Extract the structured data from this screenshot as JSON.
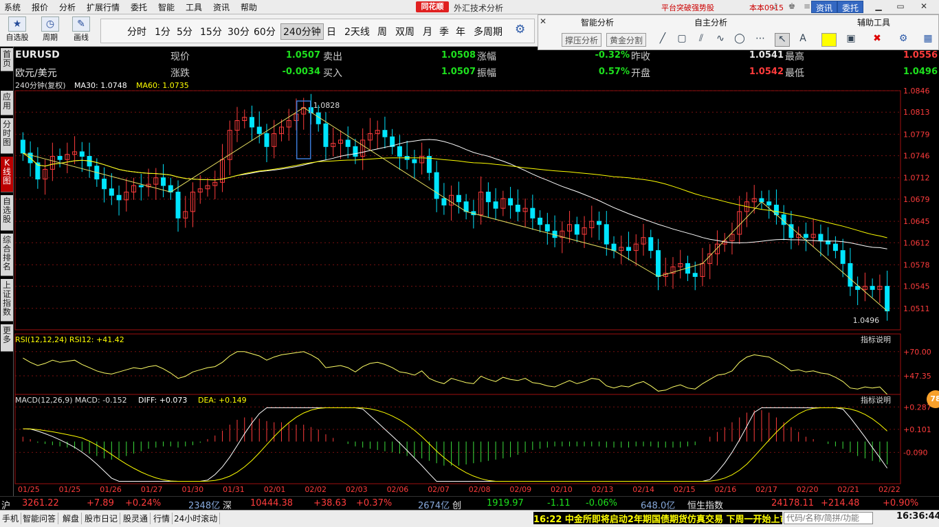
{
  "menu": [
    "系统",
    "报价",
    "分析",
    "扩展行情",
    "委托",
    "智能",
    "工具",
    "资讯",
    "帮助"
  ],
  "logo": "同花顺",
  "app_title": "外汇技术分析",
  "promo": "平台突破强势股",
  "account": "本本0915",
  "btn_news": "资讯",
  "btn_trade": "委托",
  "toolbar": {
    "self_select": "自选股",
    "cycle": "周期",
    "draw": "画线"
  },
  "periods": [
    "分时",
    "1分",
    "5分",
    "15分",
    "30分",
    "60分",
    "240分钟",
    "日",
    "2天线",
    "周",
    "双周",
    "月",
    "季",
    "年",
    "多周期"
  ],
  "active_period": "240分钟",
  "analysis": {
    "smart_title": "智能分析",
    "own_title": "自主分析",
    "aux_title": "辅助工具",
    "pressure": "撑压分析",
    "golden": "黄金分割",
    "colors": {
      "swatch": "#ffff00"
    }
  },
  "sidebar": [
    "首页",
    "应用",
    "分时图",
    "K线图",
    "自选股",
    "综合排名",
    "上证指数",
    "更多"
  ],
  "quote": {
    "code": "EURUSD",
    "name": "欧元/美元",
    "l_price": "现价",
    "price": "1.0507",
    "l_sell": "卖出",
    "sell": "1.0508",
    "l_change_pct": "涨幅",
    "change_pct": "-0.32%",
    "l_prev_close": "昨收",
    "prev_close": "1.0541",
    "l_high": "最高",
    "high": "1.0556",
    "l_change": "涨跌",
    "change": "-0.0034",
    "l_buy": "买入",
    "buy": "1.0507",
    "l_amplitude": "振幅",
    "amplitude": "0.57%",
    "l_open": "开盘",
    "open": "1.0542",
    "l_low": "最低",
    "low": "1.0496"
  },
  "chart_data": {
    "type": "candlestick",
    "period_label": "240分钟(复权)",
    "ma30": "MA30: 1.0748",
    "ma60": "MA60: 1.0735",
    "y_ticks": [
      "1.0846",
      "1.0813",
      "1.0779",
      "1.0746",
      "1.0712",
      "1.0679",
      "1.0645",
      "1.0612",
      "1.0578",
      "1.0545",
      "1.0511"
    ],
    "ylim": [
      1.0478,
      1.0846
    ],
    "x_ticks": [
      "01/25",
      "01/25",
      "01/26",
      "01/27",
      "01/30",
      "01/31",
      "02/01",
      "02/02",
      "02/03",
      "02/06",
      "02/07",
      "02/08",
      "02/09",
      "02/10",
      "02/13",
      "02/14",
      "02/15",
      "02/16",
      "02/17",
      "02/20",
      "02/21",
      "02/22"
    ],
    "high_annotation": "1.0828",
    "low_annotation": "1.0496",
    "close_series": [
      1.075,
      1.0735,
      1.071,
      1.0725,
      1.0745,
      1.074,
      1.0748,
      1.0752,
      1.0745,
      1.073,
      1.071,
      1.0695,
      1.0685,
      1.0678,
      1.069,
      1.07,
      1.0698,
      1.0702,
      1.0712,
      1.07,
      1.069,
      1.065,
      1.066,
      1.069,
      1.0695,
      1.07,
      1.0705,
      1.074,
      1.0785,
      1.08,
      1.0805,
      1.079,
      1.078,
      1.076,
      1.078,
      1.079,
      1.08,
      1.081,
      1.082,
      1.0812,
      1.0795,
      1.076,
      1.0765,
      1.077,
      1.076,
      1.0745,
      1.077,
      1.078,
      1.0785,
      1.0775,
      1.076,
      1.0745,
      1.074,
      1.0735,
      1.0745,
      1.072,
      1.068,
      1.067,
      1.0685,
      1.0675,
      1.066,
      1.0655,
      1.069,
      1.0675,
      1.0665,
      1.068,
      1.067,
      1.066,
      1.0665,
      1.065,
      1.064,
      1.063,
      1.062,
      1.063,
      1.064,
      1.0625,
      1.0635,
      1.0645,
      1.064,
      1.061,
      1.06,
      1.0605,
      1.06,
      1.061,
      1.062,
      1.06,
      1.056,
      1.0565,
      1.0575,
      1.058,
      1.0565,
      1.056,
      1.058,
      1.0595,
      1.061,
      1.0615,
      1.0625,
      1.066,
      1.0675,
      1.068,
      1.0675,
      1.067,
      1.0655,
      1.064,
      1.062,
      1.0625,
      1.062,
      1.0625,
      1.0615,
      1.061,
      1.06,
      1.058,
      1.0545,
      1.054,
      1.0545,
      1.054,
      1.0545,
      1.0507
    ],
    "rsi_label": "RSI(12,12,24)  RSI12: +41.42",
    "rsi_ticks": [
      "+70.00",
      "+47.35"
    ],
    "rsi_ylim": [
      30,
      75
    ],
    "rsi_values": [
      64,
      60,
      57,
      59,
      62,
      60,
      61,
      62,
      58,
      55,
      52,
      50,
      49,
      51,
      53,
      55,
      54,
      56,
      57,
      54,
      50,
      45,
      47,
      51,
      53,
      55,
      56,
      60,
      66,
      70,
      70,
      68,
      66,
      62,
      65,
      67,
      68,
      69,
      70,
      67,
      63,
      55,
      56,
      57,
      55,
      51,
      56,
      59,
      60,
      58,
      55,
      51,
      50,
      48,
      52,
      45,
      42,
      40,
      45,
      43,
      41,
      40,
      47,
      44,
      42,
      46,
      44,
      43,
      45,
      41,
      40,
      38,
      37,
      40,
      43,
      40,
      42,
      45,
      44,
      38,
      36,
      38,
      37,
      40,
      42,
      38,
      33,
      34,
      37,
      39,
      36,
      35,
      40,
      44,
      48,
      49,
      52,
      60,
      65,
      67,
      66,
      65,
      61,
      57,
      52,
      53,
      51,
      52,
      50,
      49,
      46,
      42,
      36,
      35,
      37,
      36,
      37,
      30
    ],
    "macd_label": "MACD(12,26,9)  MACD: -0.152",
    "diff_label": "DIFF: +0.073",
    "dea_label": "DEA: +0.149",
    "macd_ticks": [
      "+0.287",
      "+0.101",
      "-0.090"
    ],
    "macd_ylim": [
      -0.35,
      0.3
    ],
    "macd_hist": [
      0.04,
      0.02,
      -0.01,
      -0.02,
      -0.03,
      -0.04,
      -0.05,
      -0.06,
      -0.08,
      -0.1,
      -0.12,
      -0.14,
      -0.15,
      -0.14,
      -0.12,
      -0.1,
      -0.08,
      -0.06,
      -0.05,
      -0.04,
      -0.04,
      -0.05,
      -0.04,
      -0.03,
      -0.01,
      0.02,
      0.05,
      0.09,
      0.14,
      0.18,
      0.2,
      0.2,
      0.19,
      0.17,
      0.16,
      0.16,
      0.15,
      0.14,
      0.14,
      0.12,
      0.1,
      0.06,
      0.03,
      0.0,
      -0.02,
      -0.04,
      -0.05,
      -0.06,
      -0.07,
      -0.08,
      -0.09,
      -0.1,
      -0.12,
      -0.13,
      -0.14,
      -0.16,
      -0.18,
      -0.2,
      -0.2,
      -0.2,
      -0.19,
      -0.18,
      -0.17,
      -0.16,
      -0.15,
      -0.14,
      -0.13,
      -0.11,
      -0.09,
      -0.07,
      -0.06,
      -0.05,
      -0.04,
      -0.04,
      -0.04,
      -0.04,
      -0.04,
      -0.04,
      -0.04,
      -0.05,
      -0.05,
      -0.05,
      -0.05,
      -0.04,
      -0.04,
      -0.04,
      -0.05,
      -0.05,
      -0.05,
      -0.05,
      -0.04,
      -0.03,
      0.0,
      0.04,
      0.08,
      0.12,
      0.16,
      0.2,
      0.24,
      0.26,
      0.26,
      0.24,
      0.2,
      0.16,
      0.12,
      0.08,
      0.04,
      0.02,
      0.0,
      -0.02,
      -0.04,
      -0.06,
      -0.09,
      -0.12,
      -0.14,
      -0.16,
      -0.17,
      -0.19
    ]
  },
  "indexbar": {
    "sh_label": "沪",
    "sh_val": "3261.22",
    "sh_chg": "+7.89",
    "sh_pct": "+0.24%",
    "sh_vol": "2348亿",
    "sz_label": "深",
    "sz_val": "10444.38",
    "sz_chg": "+38.63",
    "sz_pct": "+0.37%",
    "sz_vol": "2674亿",
    "cy_label": "创",
    "cy_val": "1919.97",
    "cy_chg": "-1.11",
    "cy_pct": "-0.06%",
    "cy_vol": "648.0亿",
    "hs_label": "恒生指数",
    "hs_val": "24178.11",
    "hs_chg": "+214.48",
    "hs_pct": "+0.90%"
  },
  "statusbar": [
    "手机",
    "智能问答",
    "解盘",
    "股市日记",
    "股灵通",
    "行情",
    "24小时滚动"
  ],
  "news": "16:22 中金所即将启动2年期国债期货仿真交易 下周一开始上市",
  "search_placeholder": "代码/名称/简拼/功能",
  "clock": "16:36:44",
  "indicator_help": "指标说明",
  "badge": "78"
}
